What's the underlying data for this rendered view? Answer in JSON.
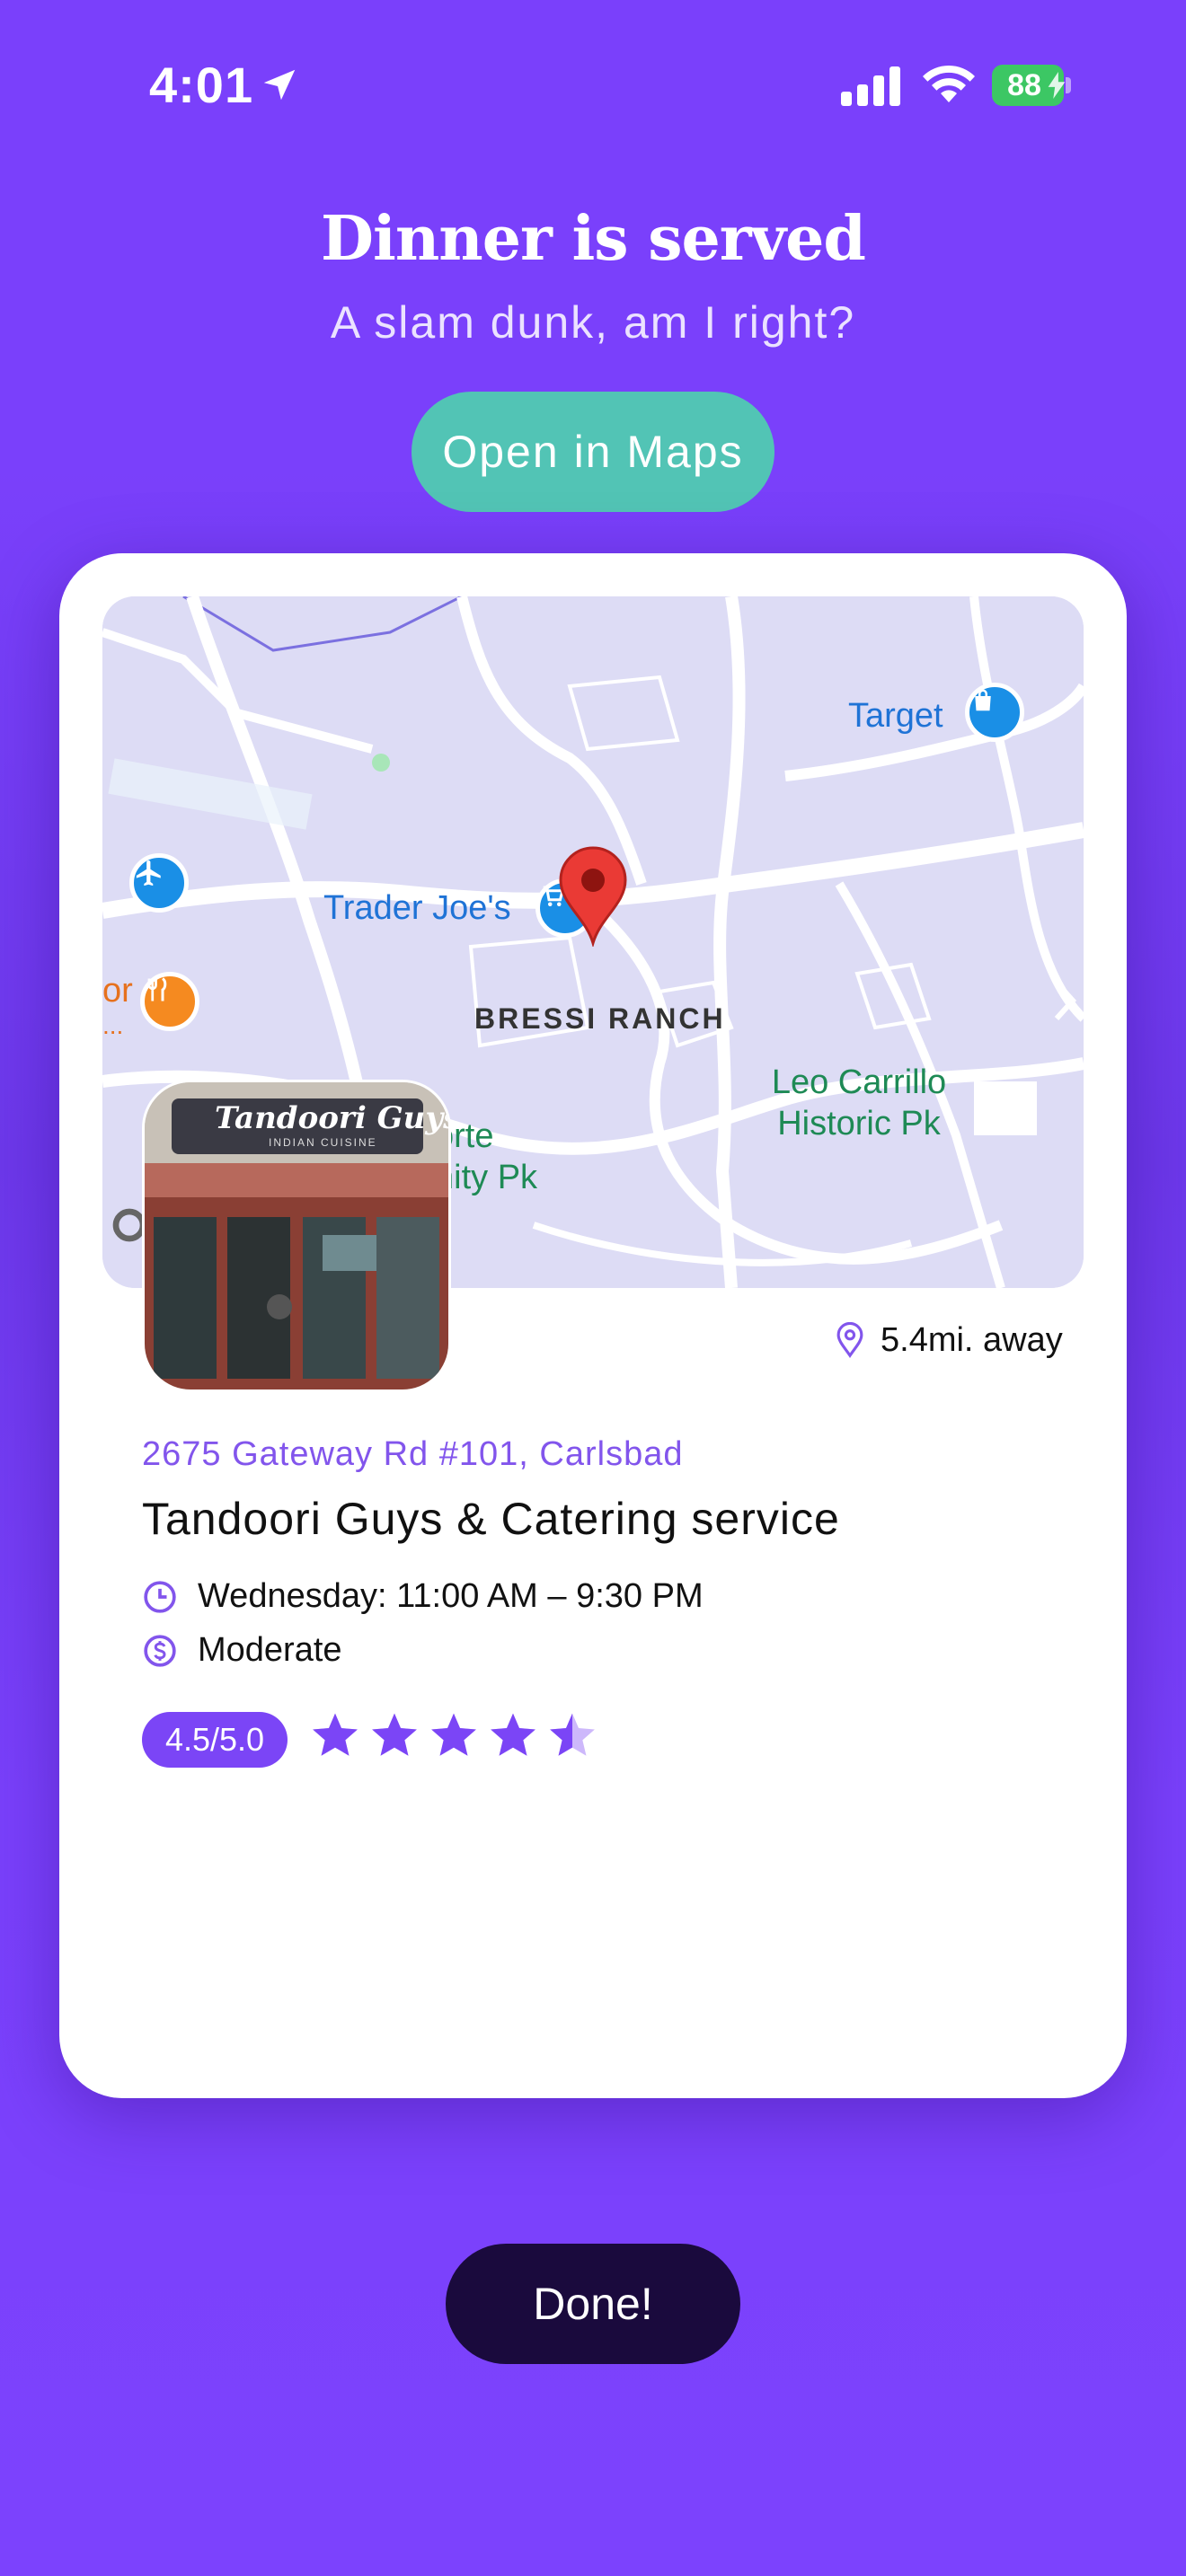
{
  "status_bar": {
    "time": "4:01",
    "battery": "88"
  },
  "header": {
    "title": "Dinner is served",
    "subtitle": "A slam dunk, am I right?",
    "open_maps_label": "Open in Maps"
  },
  "map": {
    "labels": {
      "target": "Target",
      "trader_joes": "Trader Joe's",
      "bressi": "BRESSI RANCH",
      "leo_line1": "Leo Carrillo",
      "leo_line2": "Historic Pk",
      "orte_line1": "orte",
      "orte_line2": "nity Pk",
      "or": "or",
      "dots": "..."
    }
  },
  "restaurant": {
    "distance": "5.4mi. away",
    "address": "2675 Gateway Rd #101, Carlsbad",
    "name": "Tandoori Guys & Catering service",
    "hours": "Wednesday: 11:00 AM – 9:30 PM",
    "price": "Moderate",
    "rating_label": "4.5/5.0",
    "rating": 4.5,
    "photo_sign": "Tandoori Guys",
    "photo_subsign": "INDIAN CUISINE"
  },
  "footer": {
    "done_label": "Done!"
  },
  "colors": {
    "background": "#7a40fb",
    "accent": "#7b45f6",
    "maps_button": "#52c4b5",
    "done_button": "#1a0a3d"
  }
}
